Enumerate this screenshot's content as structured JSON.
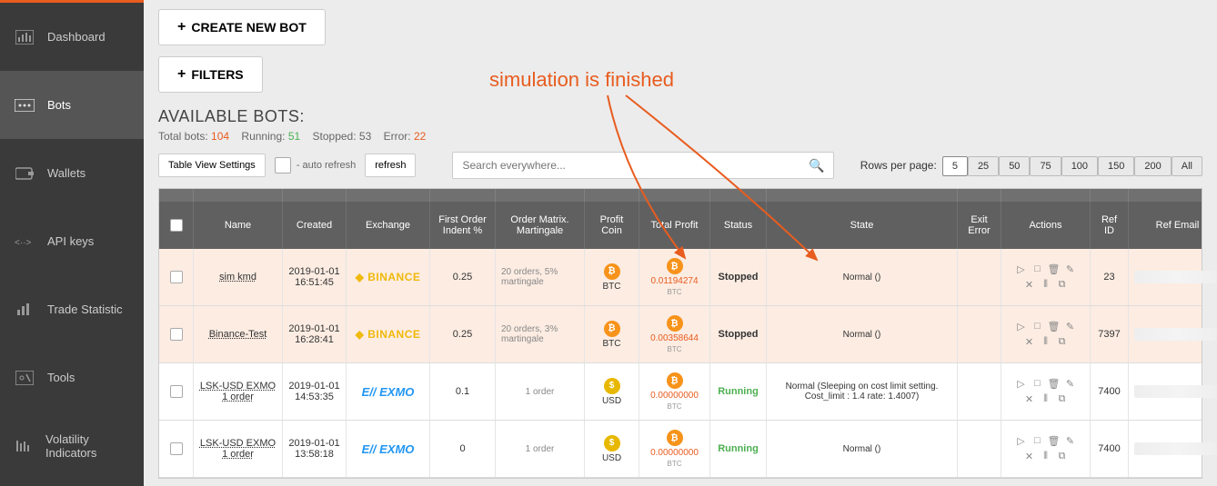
{
  "annotation": "simulation is finished",
  "sidebar": {
    "items": [
      {
        "key": "dashboard",
        "label": "Dashboard"
      },
      {
        "key": "bots",
        "label": "Bots"
      },
      {
        "key": "wallets",
        "label": "Wallets"
      },
      {
        "key": "apikeys",
        "label": "API keys"
      },
      {
        "key": "stats",
        "label": "Trade Statistic"
      },
      {
        "key": "tools",
        "label": "Tools"
      },
      {
        "key": "volatility",
        "label": "Volatility Indicators"
      }
    ]
  },
  "buttons": {
    "create_new_bot": "CREATE NEW BOT",
    "filters": "FILTERS",
    "table_view_settings": "Table View Settings",
    "auto_refresh": "- auto refresh",
    "refresh": "refresh"
  },
  "section_title": "AVAILABLE BOTS:",
  "stats": {
    "total_label": "Total bots:",
    "total_value": "104",
    "running_label": "Running:",
    "running_value": "51",
    "stopped_label": "Stopped:",
    "stopped_value": "53",
    "error_label": "Error:",
    "error_value": "22"
  },
  "search": {
    "placeholder": "Search everywhere..."
  },
  "rows_per_page": {
    "label": "Rows per page:",
    "options": [
      "5",
      "25",
      "50",
      "75",
      "100",
      "150",
      "200",
      "All"
    ],
    "active": "5"
  },
  "columns": [
    "",
    "Name",
    "Created",
    "Exchange",
    "First Order Indent %",
    "Order Matrix. Martingale",
    "Profit Coin",
    "Total Profit",
    "Status",
    "State",
    "Exit Error",
    "Actions",
    "Ref ID",
    "Ref Email"
  ],
  "rows": [
    {
      "peach": true,
      "name": "sim kmd",
      "created": "2019-01-01 16:51:45",
      "exchange": "BINANCE",
      "indent": "0.25",
      "matrix": "20 orders, 5% martingale",
      "pcoin": "BTC",
      "pcoin_type": "btc",
      "profit": "0.01194274",
      "profit_unit": "BTC",
      "status": "Stopped",
      "state": "Normal ()",
      "refid": "23"
    },
    {
      "peach": true,
      "name": "Binance-Test",
      "created": "2019-01-01 16:28:41",
      "exchange": "BINANCE",
      "indent": "0.25",
      "matrix": "20 orders, 3% martingale",
      "pcoin": "BTC",
      "pcoin_type": "btc",
      "profit": "0.00358644",
      "profit_unit": "BTC",
      "status": "Stopped",
      "state": "Normal ()",
      "refid": "7397"
    },
    {
      "peach": false,
      "name": "LSK-USD EXMO   1 order",
      "created": "2019-01-01 14:53:35",
      "exchange": "EXMO",
      "indent": "0.1",
      "matrix": "1 order",
      "pcoin": "USD",
      "pcoin_type": "usd",
      "profit": "0.00000000",
      "profit_unit": "BTC",
      "status": "Running",
      "state": "Normal (Sleeping on cost limit setting. Cost_limit : 1.4 rate: 1.4007)",
      "refid": "7400"
    },
    {
      "peach": false,
      "name": "LSK-USD EXMO   1 order",
      "created": "2019-01-01 13:58:18",
      "exchange": "EXMO",
      "indent": "0",
      "matrix": "1 order",
      "pcoin": "USD",
      "pcoin_type": "usd",
      "profit": "0.00000000",
      "profit_unit": "BTC",
      "status": "Running",
      "state": "Normal ()",
      "refid": "7400"
    }
  ]
}
